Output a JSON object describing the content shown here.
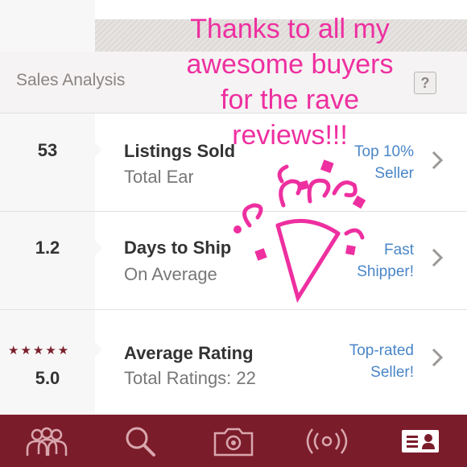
{
  "section": {
    "title": "Sales Analysis",
    "help_label": "?"
  },
  "rows": [
    {
      "value": "53",
      "title": "Listings Sold",
      "subtitle": "Total Earn",
      "badge_line1": "Top 10%",
      "badge_line2": "Seller"
    },
    {
      "value": "1.2",
      "title": "Days to Ship",
      "subtitle": "On Average",
      "badge_line1": "Fast",
      "badge_line2": "Shipper!"
    },
    {
      "value": "5.0",
      "stars": "★★★★★",
      "title": "Average Rating",
      "subtitle": "Total Ratings: 22",
      "badge_line1": "Top-rated",
      "badge_line2": "Seller!"
    }
  ],
  "overlay": {
    "lines": [
      "Thanks to all my",
      "awesome buyers",
      "for the rave",
      "reviews!!!"
    ],
    "color": "#ee2fa0"
  },
  "tabbar": {
    "color": "#7b1c2b",
    "items": [
      {
        "icon": "people-icon"
      },
      {
        "icon": "search-icon"
      },
      {
        "icon": "camera-icon"
      },
      {
        "icon": "broadcast-icon"
      },
      {
        "icon": "profile-card-icon",
        "active": true
      }
    ]
  },
  "colors": {
    "badge_blue": "#4a86c8",
    "star_maroon": "#7a1f2b"
  }
}
